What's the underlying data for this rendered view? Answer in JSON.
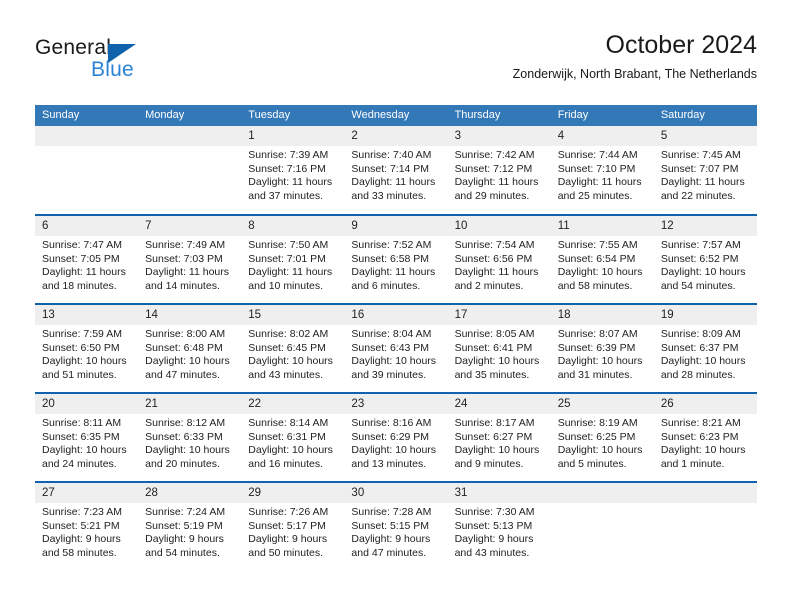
{
  "brand": {
    "name_part1": "General",
    "name_part2": "Blue",
    "accent_color": "#2a83d4",
    "triangle_color": "#1062ac"
  },
  "header": {
    "title": "October 2024",
    "subtitle": "Zonderwijk, North Brabant, The Netherlands"
  },
  "calendar": {
    "header_bg": "#3479b7",
    "row_divider_color": "#1062ac",
    "daynum_bg": "#efefef",
    "weekdays": [
      "Sunday",
      "Monday",
      "Tuesday",
      "Wednesday",
      "Thursday",
      "Friday",
      "Saturday"
    ],
    "weeks": [
      [
        {
          "day": "",
          "empty": true
        },
        {
          "day": "",
          "empty": true
        },
        {
          "day": "1",
          "sunrise": "Sunrise: 7:39 AM",
          "sunset": "Sunset: 7:16 PM",
          "daylight1": "Daylight: 11 hours",
          "daylight2": "and 37 minutes."
        },
        {
          "day": "2",
          "sunrise": "Sunrise: 7:40 AM",
          "sunset": "Sunset: 7:14 PM",
          "daylight1": "Daylight: 11 hours",
          "daylight2": "and 33 minutes."
        },
        {
          "day": "3",
          "sunrise": "Sunrise: 7:42 AM",
          "sunset": "Sunset: 7:12 PM",
          "daylight1": "Daylight: 11 hours",
          "daylight2": "and 29 minutes."
        },
        {
          "day": "4",
          "sunrise": "Sunrise: 7:44 AM",
          "sunset": "Sunset: 7:10 PM",
          "daylight1": "Daylight: 11 hours",
          "daylight2": "and 25 minutes."
        },
        {
          "day": "5",
          "sunrise": "Sunrise: 7:45 AM",
          "sunset": "Sunset: 7:07 PM",
          "daylight1": "Daylight: 11 hours",
          "daylight2": "and 22 minutes."
        }
      ],
      [
        {
          "day": "6",
          "sunrise": "Sunrise: 7:47 AM",
          "sunset": "Sunset: 7:05 PM",
          "daylight1": "Daylight: 11 hours",
          "daylight2": "and 18 minutes."
        },
        {
          "day": "7",
          "sunrise": "Sunrise: 7:49 AM",
          "sunset": "Sunset: 7:03 PM",
          "daylight1": "Daylight: 11 hours",
          "daylight2": "and 14 minutes."
        },
        {
          "day": "8",
          "sunrise": "Sunrise: 7:50 AM",
          "sunset": "Sunset: 7:01 PM",
          "daylight1": "Daylight: 11 hours",
          "daylight2": "and 10 minutes."
        },
        {
          "day": "9",
          "sunrise": "Sunrise: 7:52 AM",
          "sunset": "Sunset: 6:58 PM",
          "daylight1": "Daylight: 11 hours",
          "daylight2": "and 6 minutes."
        },
        {
          "day": "10",
          "sunrise": "Sunrise: 7:54 AM",
          "sunset": "Sunset: 6:56 PM",
          "daylight1": "Daylight: 11 hours",
          "daylight2": "and 2 minutes."
        },
        {
          "day": "11",
          "sunrise": "Sunrise: 7:55 AM",
          "sunset": "Sunset: 6:54 PM",
          "daylight1": "Daylight: 10 hours",
          "daylight2": "and 58 minutes."
        },
        {
          "day": "12",
          "sunrise": "Sunrise: 7:57 AM",
          "sunset": "Sunset: 6:52 PM",
          "daylight1": "Daylight: 10 hours",
          "daylight2": "and 54 minutes."
        }
      ],
      [
        {
          "day": "13",
          "sunrise": "Sunrise: 7:59 AM",
          "sunset": "Sunset: 6:50 PM",
          "daylight1": "Daylight: 10 hours",
          "daylight2": "and 51 minutes."
        },
        {
          "day": "14",
          "sunrise": "Sunrise: 8:00 AM",
          "sunset": "Sunset: 6:48 PM",
          "daylight1": "Daylight: 10 hours",
          "daylight2": "and 47 minutes."
        },
        {
          "day": "15",
          "sunrise": "Sunrise: 8:02 AM",
          "sunset": "Sunset: 6:45 PM",
          "daylight1": "Daylight: 10 hours",
          "daylight2": "and 43 minutes."
        },
        {
          "day": "16",
          "sunrise": "Sunrise: 8:04 AM",
          "sunset": "Sunset: 6:43 PM",
          "daylight1": "Daylight: 10 hours",
          "daylight2": "and 39 minutes."
        },
        {
          "day": "17",
          "sunrise": "Sunrise: 8:05 AM",
          "sunset": "Sunset: 6:41 PM",
          "daylight1": "Daylight: 10 hours",
          "daylight2": "and 35 minutes."
        },
        {
          "day": "18",
          "sunrise": "Sunrise: 8:07 AM",
          "sunset": "Sunset: 6:39 PM",
          "daylight1": "Daylight: 10 hours",
          "daylight2": "and 31 minutes."
        },
        {
          "day": "19",
          "sunrise": "Sunrise: 8:09 AM",
          "sunset": "Sunset: 6:37 PM",
          "daylight1": "Daylight: 10 hours",
          "daylight2": "and 28 minutes."
        }
      ],
      [
        {
          "day": "20",
          "sunrise": "Sunrise: 8:11 AM",
          "sunset": "Sunset: 6:35 PM",
          "daylight1": "Daylight: 10 hours",
          "daylight2": "and 24 minutes."
        },
        {
          "day": "21",
          "sunrise": "Sunrise: 8:12 AM",
          "sunset": "Sunset: 6:33 PM",
          "daylight1": "Daylight: 10 hours",
          "daylight2": "and 20 minutes."
        },
        {
          "day": "22",
          "sunrise": "Sunrise: 8:14 AM",
          "sunset": "Sunset: 6:31 PM",
          "daylight1": "Daylight: 10 hours",
          "daylight2": "and 16 minutes."
        },
        {
          "day": "23",
          "sunrise": "Sunrise: 8:16 AM",
          "sunset": "Sunset: 6:29 PM",
          "daylight1": "Daylight: 10 hours",
          "daylight2": "and 13 minutes."
        },
        {
          "day": "24",
          "sunrise": "Sunrise: 8:17 AM",
          "sunset": "Sunset: 6:27 PM",
          "daylight1": "Daylight: 10 hours",
          "daylight2": "and 9 minutes."
        },
        {
          "day": "25",
          "sunrise": "Sunrise: 8:19 AM",
          "sunset": "Sunset: 6:25 PM",
          "daylight1": "Daylight: 10 hours",
          "daylight2": "and 5 minutes."
        },
        {
          "day": "26",
          "sunrise": "Sunrise: 8:21 AM",
          "sunset": "Sunset: 6:23 PM",
          "daylight1": "Daylight: 10 hours",
          "daylight2": "and 1 minute."
        }
      ],
      [
        {
          "day": "27",
          "sunrise": "Sunrise: 7:23 AM",
          "sunset": "Sunset: 5:21 PM",
          "daylight1": "Daylight: 9 hours",
          "daylight2": "and 58 minutes."
        },
        {
          "day": "28",
          "sunrise": "Sunrise: 7:24 AM",
          "sunset": "Sunset: 5:19 PM",
          "daylight1": "Daylight: 9 hours",
          "daylight2": "and 54 minutes."
        },
        {
          "day": "29",
          "sunrise": "Sunrise: 7:26 AM",
          "sunset": "Sunset: 5:17 PM",
          "daylight1": "Daylight: 9 hours",
          "daylight2": "and 50 minutes."
        },
        {
          "day": "30",
          "sunrise": "Sunrise: 7:28 AM",
          "sunset": "Sunset: 5:15 PM",
          "daylight1": "Daylight: 9 hours",
          "daylight2": "and 47 minutes."
        },
        {
          "day": "31",
          "sunrise": "Sunrise: 7:30 AM",
          "sunset": "Sunset: 5:13 PM",
          "daylight1": "Daylight: 9 hours",
          "daylight2": "and 43 minutes."
        },
        {
          "day": "",
          "empty": true
        },
        {
          "day": "",
          "empty": true
        }
      ]
    ]
  }
}
